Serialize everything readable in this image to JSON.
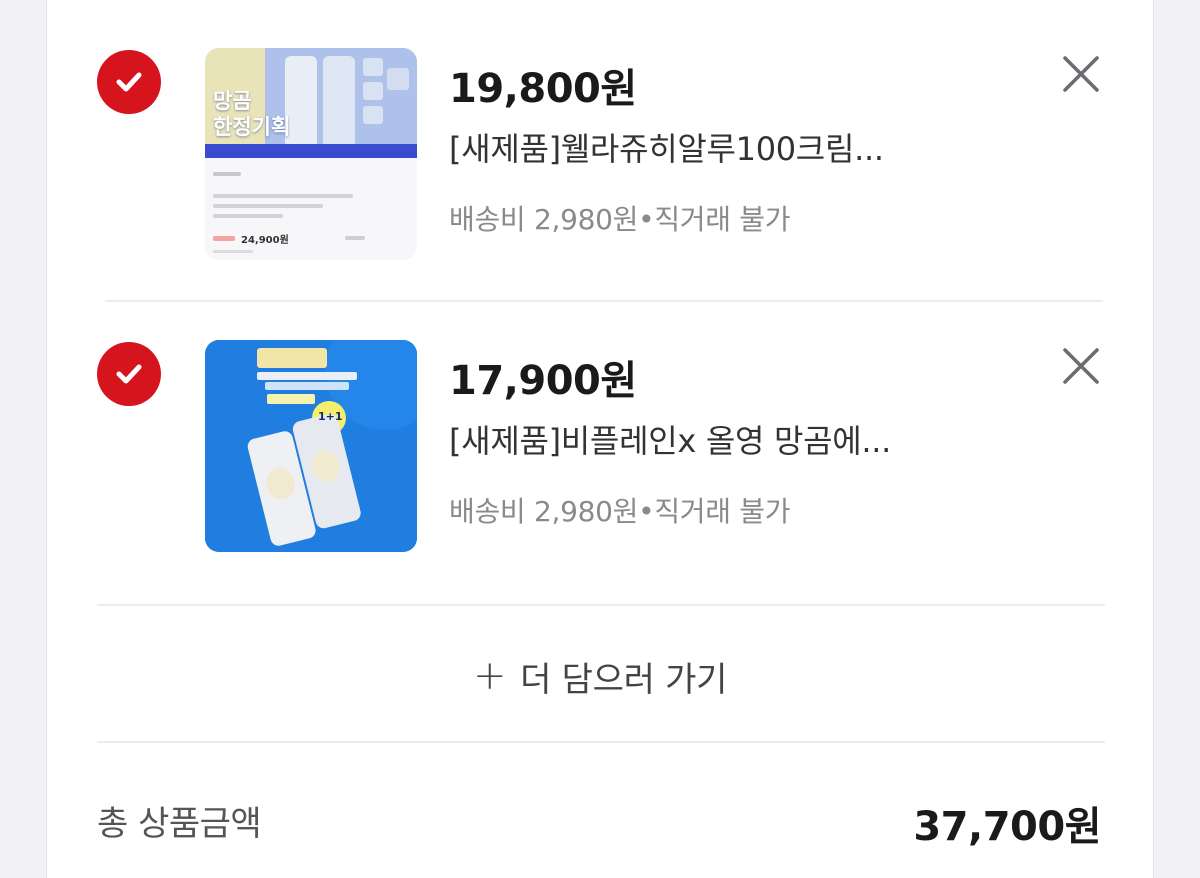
{
  "items": [
    {
      "price": "19,800원",
      "title": "[새제품]웰라쥬히알루100크림...",
      "meta": "배송비 2,980원•직거래 불가",
      "thumb_banner_text_1": "망곰",
      "thumb_banner_text_2": "한정기획",
      "thumb_price_text": "24,900원"
    },
    {
      "price": "17,900원",
      "title": "[새제품]비플레인x 올영 망곰에...",
      "meta": "배송비 2,980원•직거래 불가",
      "thumb_badge_text": "1+1"
    }
  ],
  "add_more": {
    "plus": "+",
    "label": "더 담으러 가기"
  },
  "summary": {
    "label": "총 상품금액",
    "value": "37,700원"
  },
  "colors": {
    "accent": "#d6141e",
    "text": "#1a1a1a",
    "muted": "#8a8a8e"
  },
  "icons": {
    "check": "check-circle-icon",
    "close": "close-icon",
    "plus": "plus-icon"
  }
}
